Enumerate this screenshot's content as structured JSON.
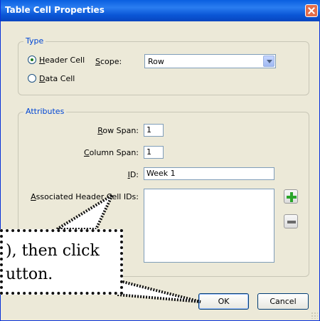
{
  "window": {
    "title": "Table Cell Properties"
  },
  "type_group": {
    "legend": "Type",
    "header_cell_label_parts": [
      "H",
      "eader Cell"
    ],
    "data_cell_label_parts": [
      "D",
      "ata Cell"
    ],
    "scope_label_parts": [
      "S",
      "cope:"
    ],
    "scope_value": "Row",
    "selected": "header"
  },
  "attributes_group": {
    "legend": "Attributes",
    "row_span_label_parts": [
      "R",
      "ow Span:"
    ],
    "row_span_value": "1",
    "column_span_label_parts": [
      "C",
      "olumn Span:"
    ],
    "column_span_value": "1",
    "id_label_parts": [
      "I",
      "D:"
    ],
    "id_value": "Week 1",
    "assoc_label_parts": [
      "A",
      "ssociated Header Cell IDs:"
    ]
  },
  "buttons": {
    "ok": "OK",
    "cancel": "Cancel"
  },
  "callout": {
    "line1": "), then click",
    "line2": "utton."
  },
  "icons": {
    "add": "plus-icon",
    "remove": "minus-icon",
    "close": "close-icon"
  }
}
